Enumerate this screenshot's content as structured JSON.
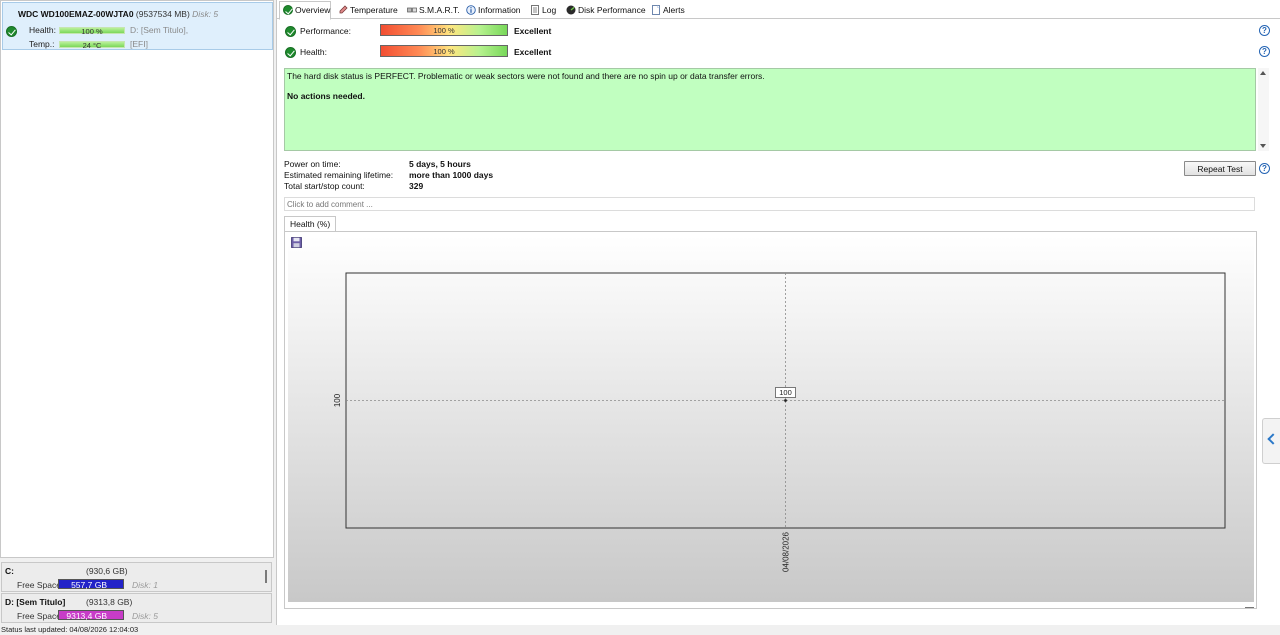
{
  "disk": {
    "model": "WDC WD100EMAZ-00WJTA0",
    "size": "(9537534 MB)",
    "disk_number": "Disk: 5",
    "health_label": "Health:",
    "health_value": "100 %",
    "health_fraction": 1.0,
    "temp_label": "Temp.:",
    "temp_value": "24 °C",
    "temp_fraction": 1.0,
    "volume_line1": "D: [Sem Titulo],",
    "volume_line2": "[EFI]"
  },
  "volumes": [
    {
      "name": "C:",
      "size": "(930,6 GB)",
      "free_label": "Free Space",
      "free_value": "557,7 GB",
      "free_color": "#2222c8",
      "disk": "Disk: 1"
    },
    {
      "name": "D: [Sem Titulo]",
      "size": "(9313,8 GB)",
      "free_label": "Free Space",
      "free_value": "9313,4 GB",
      "free_color": "#c83cc8",
      "disk": "Disk: 5"
    }
  ],
  "status_bar": "Status last updated: 04/08/2026 12:04:03",
  "tabs": [
    {
      "label": "Overview",
      "icon": "check-circle-icon"
    },
    {
      "label": "Temperature",
      "icon": "thermometer-icon"
    },
    {
      "label": "S.M.A.R.T.",
      "icon": "smart-icon"
    },
    {
      "label": "Information",
      "icon": "info-icon"
    },
    {
      "label": "Log",
      "icon": "log-icon"
    },
    {
      "label": "Disk Performance",
      "icon": "disk-performance-icon"
    },
    {
      "label": "Alerts",
      "icon": "alerts-icon"
    }
  ],
  "overview": {
    "performance_label": "Performance:",
    "performance_value": "100 %",
    "performance_rating": "Excellent",
    "health_label": "Health:",
    "health_value": "100 %",
    "health_rating": "Excellent",
    "status_message": "The hard disk status is PERFECT. Problematic or weak sectors were not found and there are no spin up or data transfer errors.",
    "action_message": "No actions needed.",
    "power_on_label": "Power on time:",
    "power_on_value": "5 days, 5 hours",
    "remaining_label": "Estimated remaining lifetime:",
    "remaining_value": "more than 1000 days",
    "startstop_label": "Total start/stop count:",
    "startstop_value": "329",
    "repeat_button": "Repeat Test",
    "comment_placeholder": "Click to add comment ...",
    "chart_tab": "Health (%)",
    "help": "?"
  },
  "colors": {
    "selected_row": "#dfeffc",
    "status_box": "#c1ffc0",
    "accent": "#2464b4"
  },
  "chart_data": {
    "type": "scatter",
    "title": "",
    "x": [
      "04/08/2026"
    ],
    "y": [
      100
    ],
    "point_labels": [
      "100"
    ],
    "ylabel": "",
    "xlabel": "",
    "y_tick_labels": [
      "100"
    ],
    "x_tick_labels": [
      "04/08/2026"
    ],
    "grid": true
  }
}
